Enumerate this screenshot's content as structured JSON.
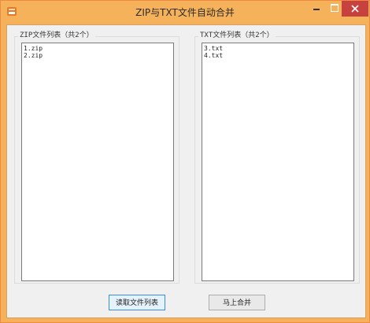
{
  "window": {
    "title": "ZIP与TXT文件自动合并"
  },
  "groups": {
    "zip": {
      "legend": "ZIP文件列表（共2个）",
      "items": [
        "1.zip",
        "2.zip"
      ]
    },
    "txt": {
      "legend": "TXT文件列表（共2个）",
      "items": [
        "3.txt",
        "4.txt"
      ]
    }
  },
  "buttons": {
    "read_label": "读取文件列表",
    "merge_label": "马上合并"
  },
  "icons": {
    "app": "app-icon",
    "minimize": "minimize-icon",
    "maximize": "maximize-icon",
    "close": "close-icon"
  },
  "colors": {
    "titlebar": "#f5b25a",
    "close_button": "#c7423e",
    "client_background": "#f0f0f0"
  }
}
